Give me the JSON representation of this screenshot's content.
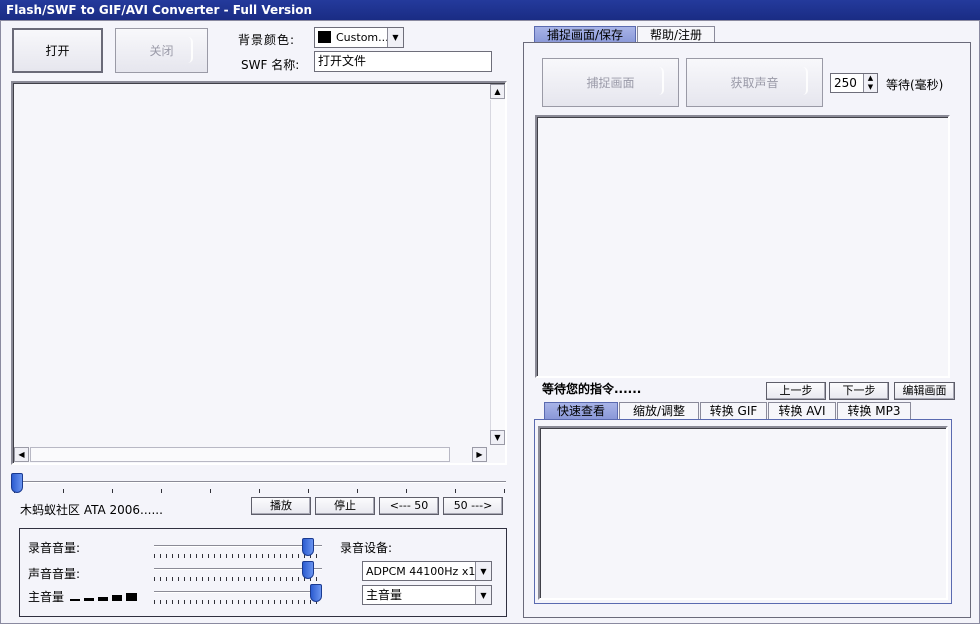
{
  "window": {
    "title": "Flash/SWF to GIF/AVI Converter - Full Version"
  },
  "left": {
    "open_button": "打开",
    "close_button": "关闭",
    "bg_color_label": "背景颜色:",
    "bg_color_value": "Custom...",
    "swf_name_label": "SWF 名称:",
    "swf_name_value": "打开文件",
    "credit_text": "木蚂蚁社区 ATA 2006......",
    "play_button": "播放",
    "stop_button": "停止",
    "back50_button": "<--- 50",
    "fwd50_button": "50 --->",
    "timeline_position": 0
  },
  "audio": {
    "record_volume_label": "录音音量:",
    "sound_volume_label": "声音音量:",
    "master_volume_label": "主音量",
    "record_device_label": "录音设备:",
    "codec_value": "ADPCM 44100Hz x1",
    "device_value": "主音量",
    "record_volume_level": 0.95,
    "sound_volume_level": 0.95,
    "master_volume_level": 1.0
  },
  "right": {
    "tab_capture": "捕捉画面/保存",
    "tab_help": "帮助/注册",
    "capture_frame_button": "捕捉画面",
    "get_sound_button": "获取声音",
    "wait_value": "250",
    "wait_label": "等待(毫秒)",
    "status_text": "等待您的指令......",
    "prev_button": "上一步",
    "next_button": "下一步",
    "edit_frame_button": "编辑画面",
    "subtabs": [
      "快速查看",
      "缩放/调整",
      "转换 GIF",
      "转换 AVI",
      "转换 MP3"
    ]
  },
  "colors": {
    "accent": "#8a98d8",
    "title_bg": "#1a2c84",
    "swatch": "#000000"
  }
}
